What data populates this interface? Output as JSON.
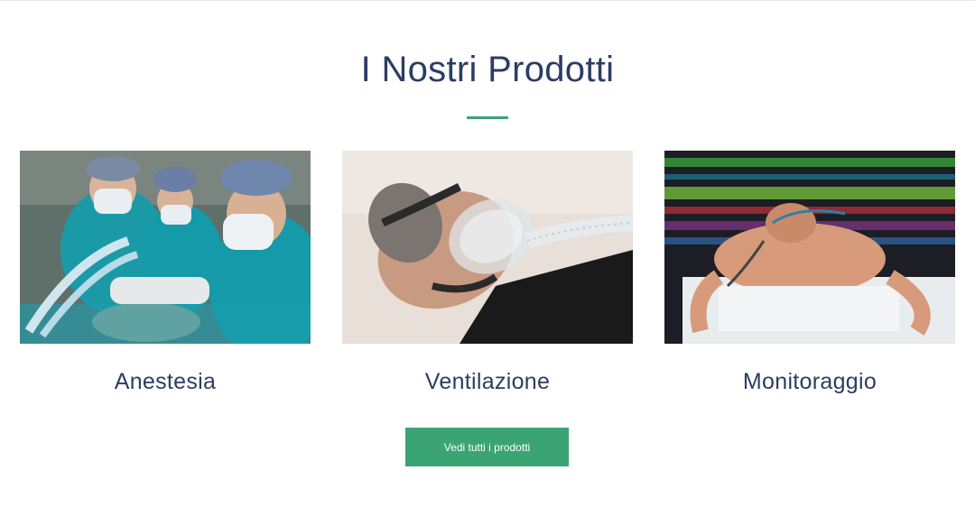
{
  "section": {
    "title": "I Nostri Prodotti"
  },
  "products": [
    {
      "name": "Anestesia"
    },
    {
      "name": "Ventilazione"
    },
    {
      "name": "Monitoraggio"
    }
  ],
  "cta": {
    "label": "Vedi tutti i prodotti"
  },
  "colors": {
    "title": "#2b3d63",
    "accent": "#3aa474",
    "background": "#ffffff"
  }
}
